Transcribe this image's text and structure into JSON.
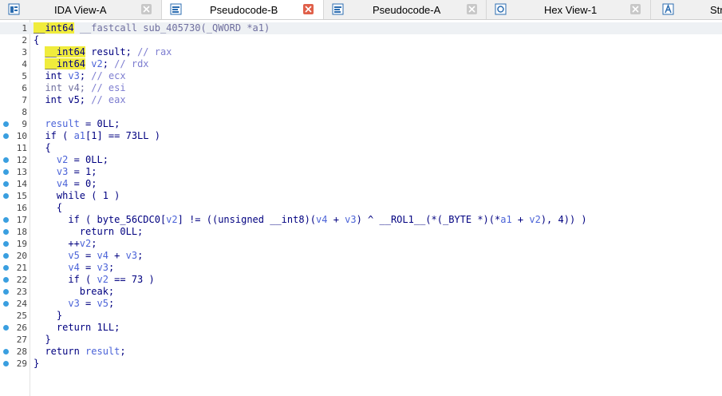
{
  "tabs": [
    {
      "label": "IDA View-A",
      "icon": "ida-view-icon",
      "active": false
    },
    {
      "label": "Pseudocode-B",
      "icon": "pseudocode-icon",
      "active": true
    },
    {
      "label": "Pseudocode-A",
      "icon": "pseudocode-icon",
      "active": false
    },
    {
      "label": "Hex View-1",
      "icon": "hex-view-icon",
      "active": false
    },
    {
      "label": "Str",
      "icon": "strings-icon",
      "active": false
    }
  ],
  "code": {
    "current_line": 1,
    "lines": [
      {
        "n": "1",
        "dot": false,
        "tokens": [
          [
            "hl",
            "__int64"
          ],
          [
            "t",
            " "
          ],
          [
            "gray",
            "__fastcall sub_405730(_QWORD *a1)"
          ]
        ]
      },
      {
        "n": "2",
        "dot": false,
        "tokens": [
          [
            "t",
            "{"
          ]
        ]
      },
      {
        "n": "3",
        "dot": false,
        "tokens": [
          [
            "t",
            "  "
          ],
          [
            "hl",
            "__int64"
          ],
          [
            "t",
            " result; "
          ],
          [
            "cmt",
            "// rax"
          ]
        ]
      },
      {
        "n": "4",
        "dot": false,
        "tokens": [
          [
            "t",
            "  "
          ],
          [
            "hl",
            "__int64"
          ],
          [
            "t",
            " "
          ],
          [
            "var",
            "v2"
          ],
          [
            "t",
            "; "
          ],
          [
            "cmt",
            "// rdx"
          ]
        ]
      },
      {
        "n": "5",
        "dot": false,
        "tokens": [
          [
            "t",
            "  int "
          ],
          [
            "var",
            "v3"
          ],
          [
            "t",
            "; "
          ],
          [
            "cmt",
            "// ecx"
          ]
        ]
      },
      {
        "n": "6",
        "dot": false,
        "tokens": [
          [
            "t",
            "  "
          ],
          [
            "gray",
            "int v4; "
          ],
          [
            "cmt",
            "// esi"
          ]
        ]
      },
      {
        "n": "7",
        "dot": false,
        "tokens": [
          [
            "t",
            "  int v5; "
          ],
          [
            "cmt",
            "// eax"
          ]
        ]
      },
      {
        "n": "8",
        "dot": false,
        "tokens": []
      },
      {
        "n": "9",
        "dot": true,
        "tokens": [
          [
            "t",
            "  "
          ],
          [
            "var",
            "result"
          ],
          [
            "t",
            " = 0LL;"
          ]
        ]
      },
      {
        "n": "10",
        "dot": true,
        "tokens": [
          [
            "t",
            "  if ( "
          ],
          [
            "var",
            "a1"
          ],
          [
            "t",
            "[1] == 73LL )"
          ]
        ]
      },
      {
        "n": "11",
        "dot": false,
        "tokens": [
          [
            "t",
            "  {"
          ]
        ]
      },
      {
        "n": "12",
        "dot": true,
        "tokens": [
          [
            "t",
            "    "
          ],
          [
            "var",
            "v2"
          ],
          [
            "t",
            " = 0LL;"
          ]
        ]
      },
      {
        "n": "13",
        "dot": true,
        "tokens": [
          [
            "t",
            "    "
          ],
          [
            "var",
            "v3"
          ],
          [
            "t",
            " = 1;"
          ]
        ]
      },
      {
        "n": "14",
        "dot": true,
        "tokens": [
          [
            "t",
            "    "
          ],
          [
            "var",
            "v4"
          ],
          [
            "t",
            " = 0;"
          ]
        ]
      },
      {
        "n": "15",
        "dot": true,
        "tokens": [
          [
            "t",
            "    while ( 1 )"
          ]
        ]
      },
      {
        "n": "16",
        "dot": false,
        "tokens": [
          [
            "t",
            "    {"
          ]
        ]
      },
      {
        "n": "17",
        "dot": true,
        "tokens": [
          [
            "t",
            "      if ( byte_56CDC0["
          ],
          [
            "var",
            "v2"
          ],
          [
            "t",
            "] != ((unsigned __int8)("
          ],
          [
            "var",
            "v4"
          ],
          [
            "t",
            " + "
          ],
          [
            "var",
            "v3"
          ],
          [
            "t",
            ") ^ __ROL1__(*(_BYTE *)(*"
          ],
          [
            "var",
            "a1"
          ],
          [
            "t",
            " + "
          ],
          [
            "var",
            "v2"
          ],
          [
            "t",
            "), 4)) )"
          ]
        ]
      },
      {
        "n": "18",
        "dot": true,
        "tokens": [
          [
            "t",
            "        return 0LL;"
          ]
        ]
      },
      {
        "n": "19",
        "dot": true,
        "tokens": [
          [
            "t",
            "      ++"
          ],
          [
            "var",
            "v2"
          ],
          [
            "t",
            ";"
          ]
        ]
      },
      {
        "n": "20",
        "dot": true,
        "tokens": [
          [
            "t",
            "      "
          ],
          [
            "var",
            "v5"
          ],
          [
            "t",
            " = "
          ],
          [
            "var",
            "v4"
          ],
          [
            "t",
            " + "
          ],
          [
            "var",
            "v3"
          ],
          [
            "t",
            ";"
          ]
        ]
      },
      {
        "n": "21",
        "dot": true,
        "tokens": [
          [
            "t",
            "      "
          ],
          [
            "var",
            "v4"
          ],
          [
            "t",
            " = "
          ],
          [
            "var",
            "v3"
          ],
          [
            "t",
            ";"
          ]
        ]
      },
      {
        "n": "22",
        "dot": true,
        "tokens": [
          [
            "t",
            "      if ( "
          ],
          [
            "var",
            "v2"
          ],
          [
            "t",
            " == 73 )"
          ]
        ]
      },
      {
        "n": "23",
        "dot": true,
        "tokens": [
          [
            "t",
            "        break;"
          ]
        ]
      },
      {
        "n": "24",
        "dot": true,
        "tokens": [
          [
            "t",
            "      "
          ],
          [
            "var",
            "v3"
          ],
          [
            "t",
            " = "
          ],
          [
            "var",
            "v5"
          ],
          [
            "t",
            ";"
          ]
        ]
      },
      {
        "n": "25",
        "dot": false,
        "tokens": [
          [
            "t",
            "    }"
          ]
        ]
      },
      {
        "n": "26",
        "dot": true,
        "tokens": [
          [
            "t",
            "    return 1LL;"
          ]
        ]
      },
      {
        "n": "27",
        "dot": false,
        "tokens": [
          [
            "t",
            "  }"
          ]
        ]
      },
      {
        "n": "28",
        "dot": true,
        "tokens": [
          [
            "t",
            "  return "
          ],
          [
            "var",
            "result"
          ],
          [
            "t",
            ";"
          ]
        ]
      },
      {
        "n": "29",
        "dot": true,
        "tokens": [
          [
            "t",
            "}"
          ]
        ]
      }
    ]
  },
  "colors": {
    "breakpoint_dot": "#3a9fe0",
    "type_highlight": "#f0ec3c",
    "active_close": "#e0604a"
  }
}
